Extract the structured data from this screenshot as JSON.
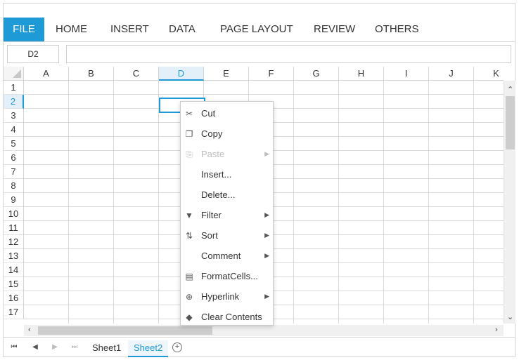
{
  "ribbon": {
    "tabs": [
      "FILE",
      "HOME",
      "INSERT",
      "DATA",
      "PAGE LAYOUT",
      "REVIEW",
      "OTHERS"
    ]
  },
  "formula_bar": {
    "name_box": "D2",
    "formula": ""
  },
  "grid": {
    "columns": [
      "A",
      "B",
      "C",
      "D",
      "E",
      "F",
      "G",
      "H",
      "I",
      "J",
      "K"
    ],
    "rows": [
      "1",
      "2",
      "3",
      "4",
      "5",
      "6",
      "7",
      "8",
      "9",
      "10",
      "11",
      "12",
      "13",
      "14",
      "15",
      "16",
      "17"
    ],
    "selected_column": "D",
    "selected_row": "2"
  },
  "context_menu": {
    "items": [
      {
        "label": "Cut",
        "icon": "scissors-icon",
        "submenu": false,
        "enabled": true
      },
      {
        "label": "Copy",
        "icon": "copy-icon",
        "submenu": false,
        "enabled": true
      },
      {
        "label": "Paste",
        "icon": "paste-icon",
        "submenu": true,
        "enabled": false
      },
      {
        "label": "Insert...",
        "icon": "",
        "submenu": false,
        "enabled": true
      },
      {
        "label": "Delete...",
        "icon": "",
        "submenu": false,
        "enabled": true
      },
      {
        "label": "Filter",
        "icon": "filter-icon",
        "submenu": true,
        "enabled": true
      },
      {
        "label": "Sort",
        "icon": "sort-icon",
        "submenu": true,
        "enabled": true
      },
      {
        "label": "Comment",
        "icon": "",
        "submenu": true,
        "enabled": true
      },
      {
        "label": "FormatCells...",
        "icon": "format-cells-icon",
        "submenu": false,
        "enabled": true
      },
      {
        "label": "Hyperlink",
        "icon": "hyperlink-icon",
        "submenu": true,
        "enabled": true
      },
      {
        "label": "Clear Contents",
        "icon": "eraser-icon",
        "submenu": false,
        "enabled": true
      }
    ]
  },
  "sheets": {
    "tabs": [
      "Sheet1",
      "Sheet2"
    ],
    "active": "Sheet2"
  },
  "colors": {
    "accent": "#1e9ad6"
  }
}
